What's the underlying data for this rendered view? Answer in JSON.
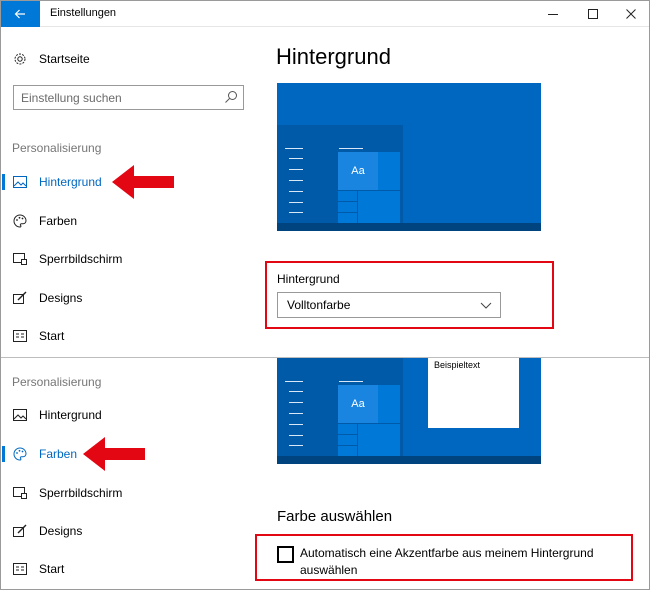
{
  "window": {
    "title": "Einstellungen",
    "controls": {
      "minimize": "minimize-icon",
      "maximize": "maximize-icon",
      "close": "close-icon"
    }
  },
  "colors": {
    "accent": "#0078d7",
    "arrow": "#e30613",
    "highlight_box": "#e30613",
    "wallpaper": "#0067c0"
  },
  "sidebar": {
    "home_label": "Startseite",
    "search_placeholder": "Einstellung suchen",
    "section_title": "Personalisierung",
    "items": [
      {
        "label": "Hintergrund",
        "icon": "picture-icon"
      },
      {
        "label": "Farben",
        "icon": "palette-icon"
      },
      {
        "label": "Sperrbildschirm",
        "icon": "lockscreen-icon"
      },
      {
        "label": "Designs",
        "icon": "brush-icon"
      },
      {
        "label": "Start",
        "icon": "start-icon"
      }
    ]
  },
  "background_page": {
    "title": "Hintergrund",
    "preview_tile_text": "Aa",
    "field_label": "Hintergrund",
    "dropdown_value": "Volltonfarbe"
  },
  "colors_page": {
    "preview_tile_text": "Aa",
    "sample_text": "Beispieltext",
    "section_title": "Farbe auswählen",
    "auto_accent_label": "Automatisch eine Akzentfarbe aus meinem Hintergrund auswählen",
    "auto_accent_checked": false
  }
}
